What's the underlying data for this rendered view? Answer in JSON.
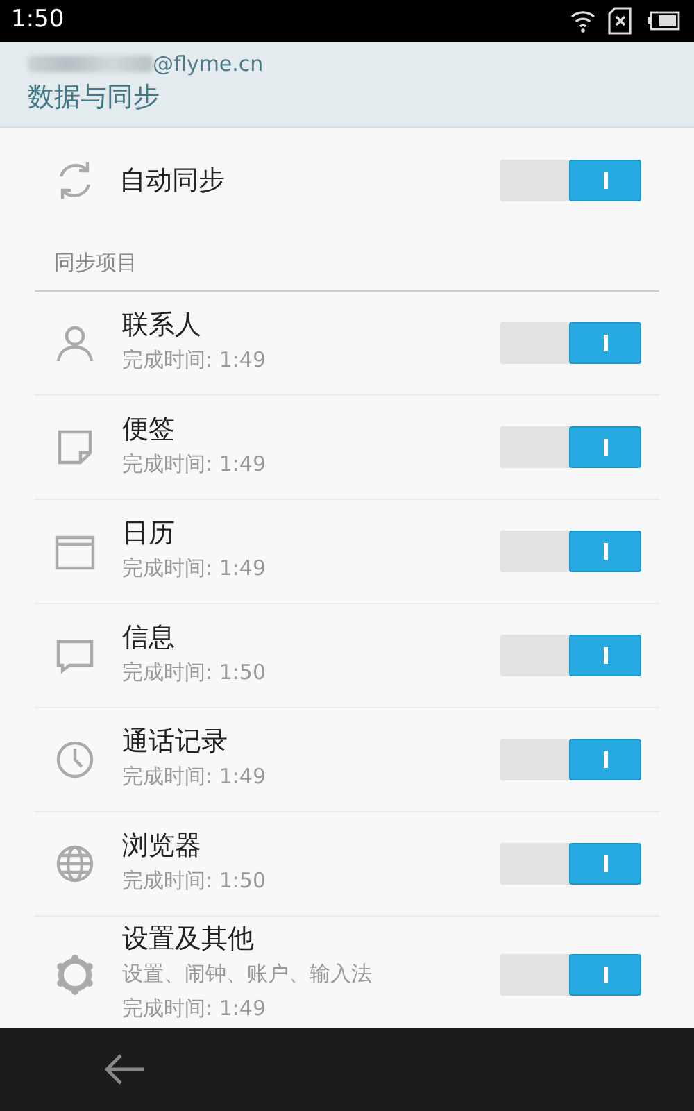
{
  "status_bar": {
    "time": "1:50"
  },
  "header": {
    "account": "@flyme.cn",
    "title": "数据与同步"
  },
  "auto_sync": {
    "label": "自动同步",
    "on": true
  },
  "section": {
    "title": "同步项目"
  },
  "items": [
    {
      "title": "联系人",
      "time": "完成时间: 1:49",
      "on": true
    },
    {
      "title": "便签",
      "time": "完成时间: 1:49",
      "on": true
    },
    {
      "title": "日历",
      "time": "完成时间: 1:49",
      "on": true
    },
    {
      "title": "信息",
      "time": "完成时间: 1:50",
      "on": true
    },
    {
      "title": "通话记录",
      "time": "完成时间: 1:49",
      "on": true
    },
    {
      "title": "浏览器",
      "time": "完成时间: 1:50",
      "on": true
    },
    {
      "title": "设置及其他",
      "detail": "设置、闹钟、账户、输入法",
      "time": "完成时间: 1:49",
      "on": true
    }
  ]
}
